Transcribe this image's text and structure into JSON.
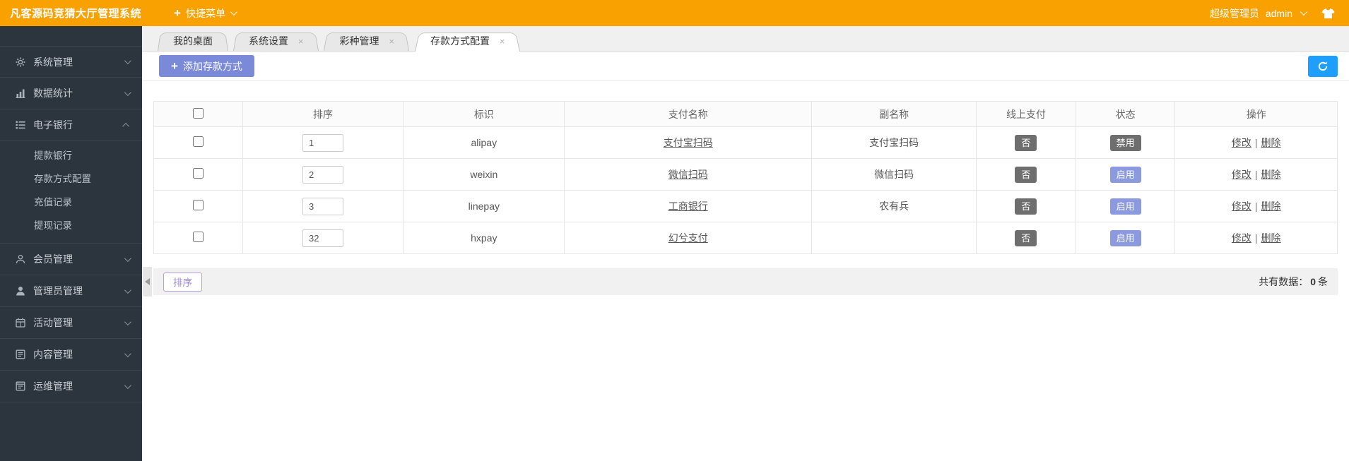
{
  "topbar": {
    "title": "凡客源码竞猜大厅管理系统",
    "quick_menu_label": "快捷菜单",
    "role_label": "超级管理员",
    "username": "admin"
  },
  "sidebar": {
    "items": [
      {
        "label": "系统管理",
        "icon": "gear-icon"
      },
      {
        "label": "数据统计",
        "icon": "bar-chart-icon"
      },
      {
        "label": "电子银行",
        "icon": "list-icon",
        "expanded": true,
        "children": [
          {
            "label": "提款银行"
          },
          {
            "label": "存款方式配置"
          },
          {
            "label": "充值记录"
          },
          {
            "label": "提现记录"
          }
        ]
      },
      {
        "label": "会员管理",
        "icon": "user-outline-icon"
      },
      {
        "label": "管理员管理",
        "icon": "user-solid-icon"
      },
      {
        "label": "活动管理",
        "icon": "calendar-icon"
      },
      {
        "label": "内容管理",
        "icon": "content-icon"
      },
      {
        "label": "运维管理",
        "icon": "ops-icon"
      }
    ]
  },
  "tabs": [
    {
      "label": "我的桌面",
      "closable": false,
      "active": false
    },
    {
      "label": "系统设置",
      "closable": true,
      "active": false
    },
    {
      "label": "彩种管理",
      "closable": true,
      "active": false
    },
    {
      "label": "存款方式配置",
      "closable": true,
      "active": true
    }
  ],
  "tab_close_glyph": "×",
  "toolbar": {
    "add_button_label": "添加存款方式"
  },
  "table": {
    "headers": {
      "sort": "排序",
      "identifier": "标识",
      "pay_name": "支付名称",
      "sub_name": "副名称",
      "online_pay": "线上支付",
      "status": "状态",
      "actions": "操作"
    },
    "action_separator": "|",
    "rows": [
      {
        "sort": "1",
        "identifier": "alipay",
        "pay_name": "支付宝扫码",
        "sub_name": "支付宝扫码",
        "online_pay": "否",
        "status": "禁用",
        "modify": "修改",
        "delete": "删除"
      },
      {
        "sort": "2",
        "identifier": "weixin",
        "pay_name": "微信扫码",
        "sub_name": "微信扫码",
        "online_pay": "否",
        "status": "启用",
        "modify": "修改",
        "delete": "删除"
      },
      {
        "sort": "3",
        "identifier": "linepay",
        "pay_name": "工商银行",
        "sub_name": "农有兵",
        "online_pay": "否",
        "status": "启用",
        "modify": "修改",
        "delete": "删除"
      },
      {
        "sort": "32",
        "identifier": "hxpay",
        "pay_name": "幻兮支付",
        "sub_name": "",
        "online_pay": "否",
        "status": "启用",
        "modify": "修改",
        "delete": "删除"
      }
    ]
  },
  "footer": {
    "sort_button_label": "排序",
    "total_label": "共有数据：",
    "total_count": "0",
    "total_unit": "条"
  },
  "colors": {
    "topbar_orange": "#f8a100",
    "sidebar_dark": "#2c353e",
    "refresh_blue": "#1e9fff",
    "add_button_periwinkle": "#7b8ad8",
    "enabled_badge": "#8b9ade",
    "disabled_badge": "#6e6e6e"
  }
}
